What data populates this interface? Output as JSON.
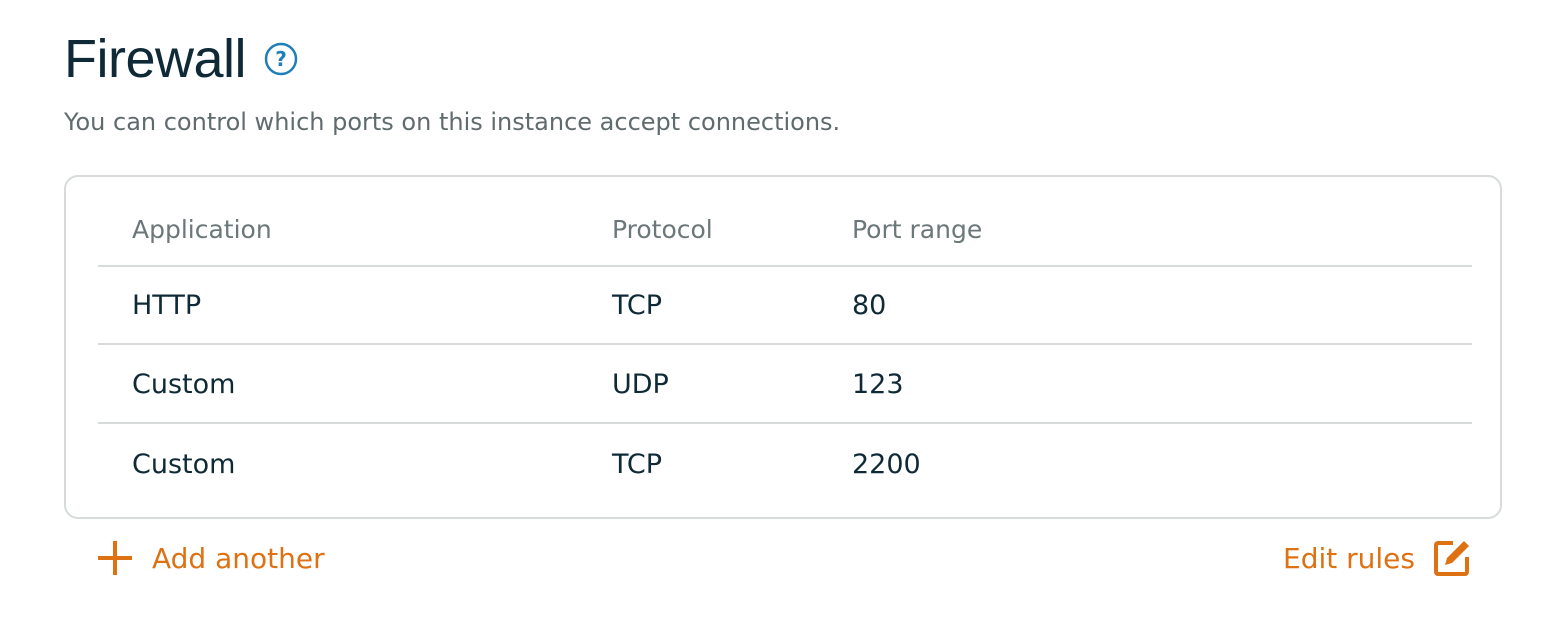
{
  "header": {
    "title": "Firewall",
    "subtitle": "You can control which ports on this instance accept connections."
  },
  "table": {
    "columns": [
      "Application",
      "Protocol",
      "Port range"
    ],
    "rows": [
      {
        "application": "HTTP",
        "protocol": "TCP",
        "port_range": "80"
      },
      {
        "application": "Custom",
        "protocol": "UDP",
        "port_range": "123"
      },
      {
        "application": "Custom",
        "protocol": "TCP",
        "port_range": "2200"
      }
    ]
  },
  "actions": {
    "add_label": "Add another",
    "edit_label": "Edit rules"
  },
  "icons": {
    "help": "question-circle-icon",
    "add": "plus-icon",
    "edit": "edit-square-icon"
  },
  "colors": {
    "title": "#0f2a36",
    "accent": "#de7212",
    "help_icon": "#1f7fb8",
    "border": "#d7dbdc"
  }
}
